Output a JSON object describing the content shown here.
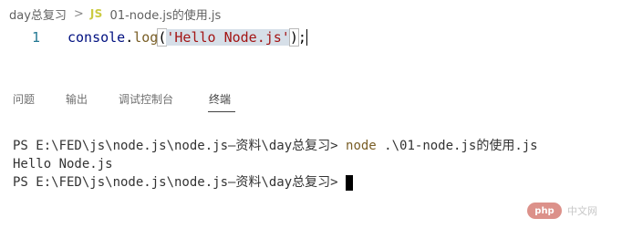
{
  "breadcrumb": {
    "folder": "day总复习",
    "separator": ">",
    "file_icon": "JS",
    "file": "01-node.js的使用.js"
  },
  "editor": {
    "line_number": "1",
    "code": {
      "object": "console",
      "dot": ".",
      "method": "log",
      "open_paren": "(",
      "string": "'Hello Node.js'",
      "close_paren": ")",
      "semicolon": ";"
    }
  },
  "panel": {
    "tabs": [
      {
        "label": "问题",
        "active": false
      },
      {
        "label": "输出",
        "active": false
      },
      {
        "label": "调试控制台",
        "active": false
      },
      {
        "label": "终端",
        "active": true
      }
    ]
  },
  "terminal": {
    "prompt": "PS E:\\FED\\js\\node.js\\node.js—资料\\day总复习>",
    "command": "node",
    "command_arg": ".\\01-node.js的使用.js",
    "output": "Hello Node.js"
  },
  "watermark": {
    "logo": "php",
    "site": "中文网"
  },
  "colors": {
    "line_number": "#237893",
    "identifier": "#001080",
    "function": "#795e26",
    "string": "#a31515",
    "selection": "#d6dfe8",
    "js_icon": "#cbcb41"
  },
  "icons": {
    "file_icon": "javascript-file-icon",
    "chevron": "chevron-right-icon"
  }
}
